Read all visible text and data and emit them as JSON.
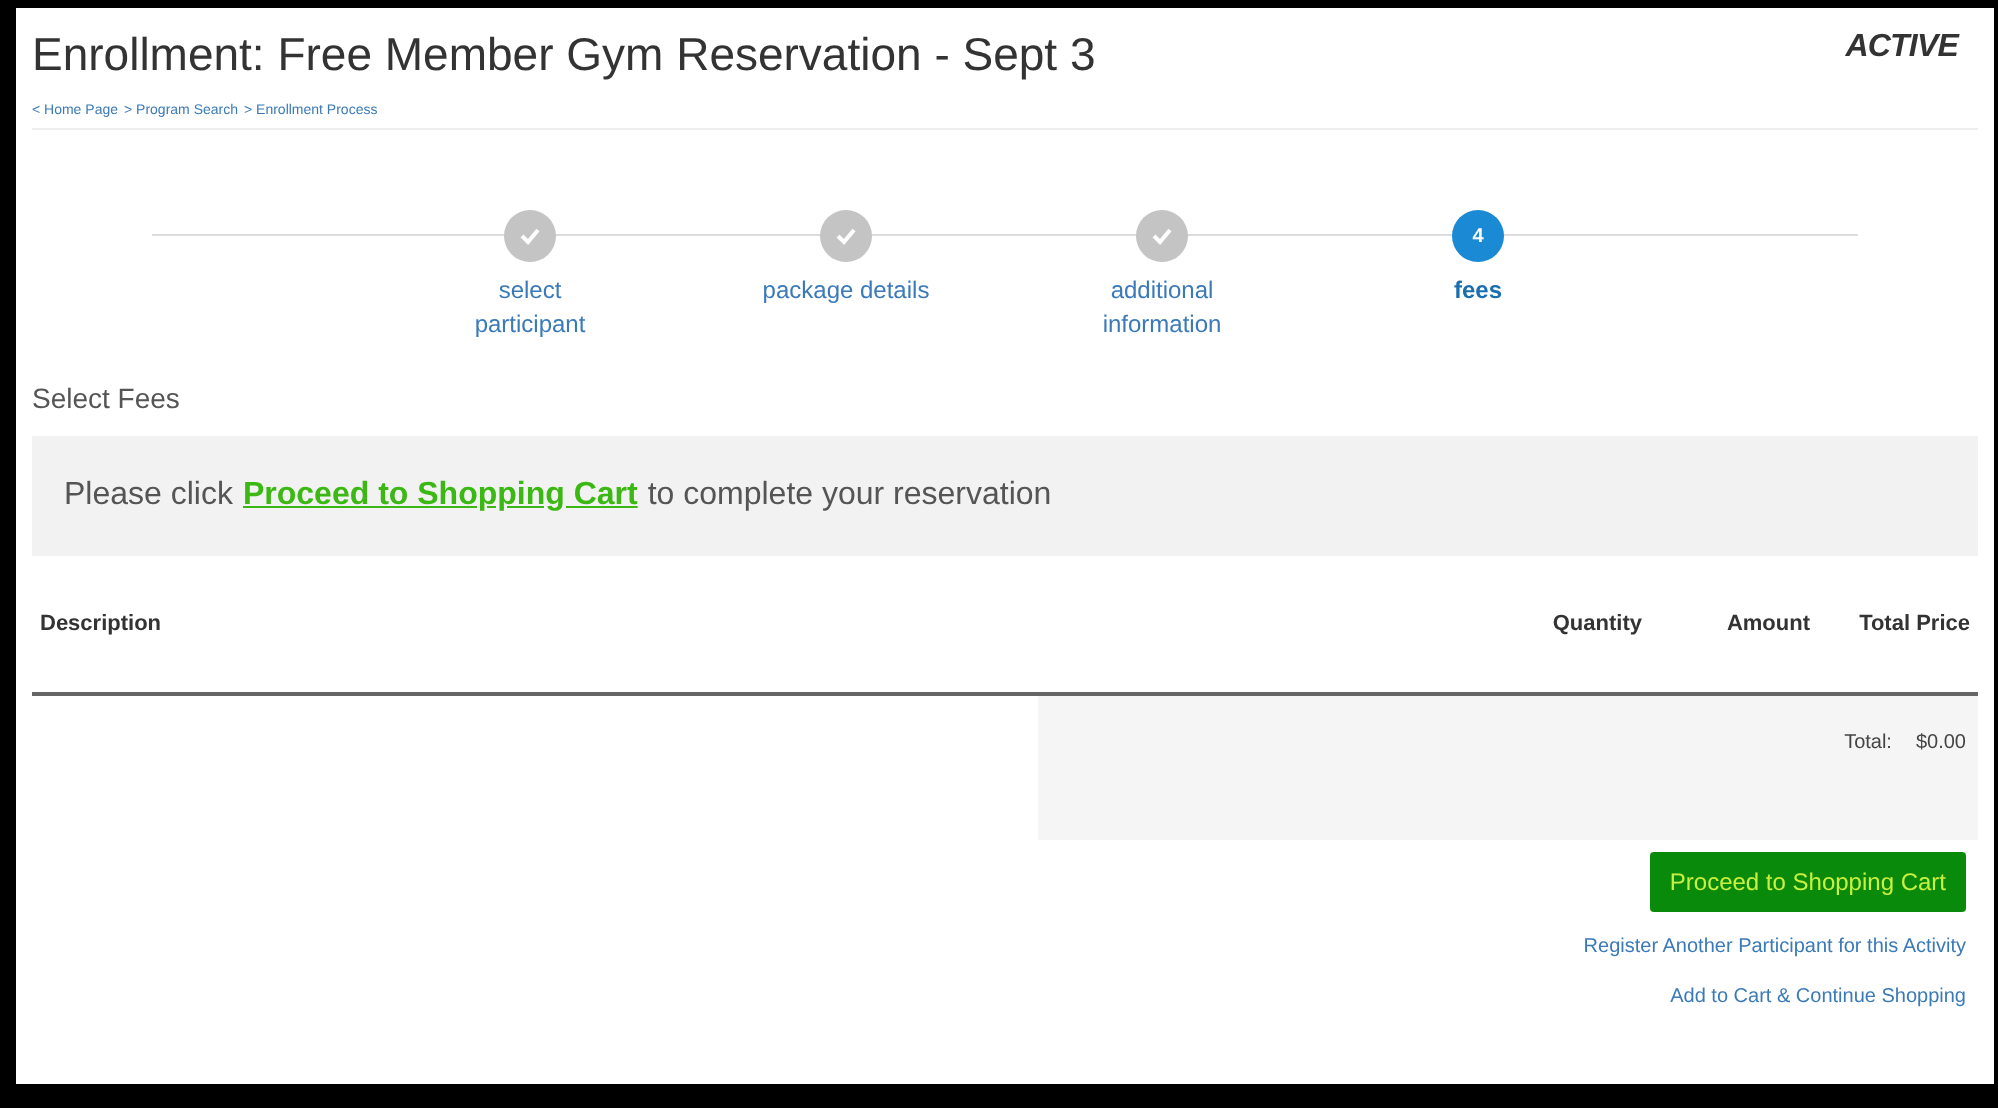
{
  "header": {
    "title": "Enrollment: Free Member Gym Reservation - Sept 3",
    "logo": "ACTIVE"
  },
  "breadcrumb": [
    "< Home Page",
    "> Program Search",
    "> Enrollment Process"
  ],
  "steps": [
    {
      "kind": "done",
      "label": "select participant"
    },
    {
      "kind": "done",
      "label": "package details"
    },
    {
      "kind": "done",
      "label": "additional information"
    },
    {
      "kind": "current",
      "number": "4",
      "label": "fees"
    }
  ],
  "section_title": "Select Fees",
  "notice": {
    "before": "Please click",
    "link": "Proceed to Shopping Cart",
    "after": "to complete your reservation"
  },
  "table": {
    "columns": [
      "Description",
      "Quantity",
      "Amount",
      "Total Price"
    ],
    "total_label": "Total:",
    "total_value": "$0.00"
  },
  "actions": {
    "primary": "Proceed to Shopping Cart",
    "links": [
      "Register Another Participant for this Activity",
      "Add to Cart & Continue Shopping"
    ]
  }
}
